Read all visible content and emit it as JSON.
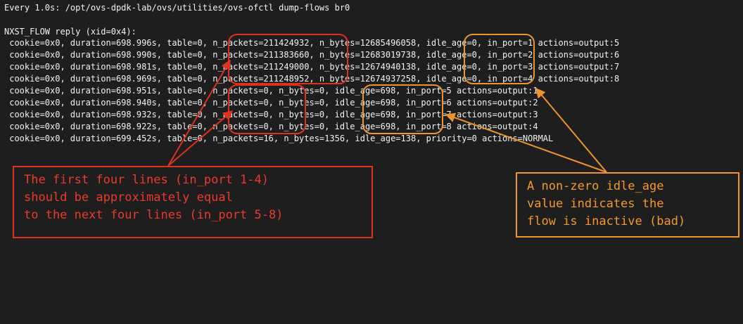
{
  "terminal": {
    "header": "Every 1.0s: /opt/ovs-dpdk-lab/ovs/utilities/ovs-ofctl dump-flows br0",
    "reply": "NXST_FLOW reply (xid=0x4):",
    "flows": [
      " cookie=0x0, duration=698.996s, table=0, n_packets=211424932, n_bytes=12685496058, idle_age=0, in_port=1 actions=output:5",
      " cookie=0x0, duration=698.990s, table=0, n_packets=211383660, n_bytes=12683019738, idle_age=0, in_port=2 actions=output:6",
      " cookie=0x0, duration=698.981s, table=0, n_packets=211249000, n_bytes=12674940138, idle_age=0, in_port=3 actions=output:7",
      " cookie=0x0, duration=698.969s, table=0, n_packets=211248952, n_bytes=12674937258, idle_age=0, in_port=4 actions=output:8",
      " cookie=0x0, duration=698.951s, table=0, n_packets=0, n_bytes=0, idle_age=698, in_port=5 actions=output:1",
      " cookie=0x0, duration=698.940s, table=0, n_packets=0, n_bytes=0, idle_age=698, in_port=6 actions=output:2",
      " cookie=0x0, duration=698.932s, table=0, n_packets=0, n_bytes=0, idle_age=698, in_port=7 actions=output:3",
      " cookie=0x0, duration=698.922s, table=0, n_packets=0, n_bytes=0, idle_age=698, in_port=8 actions=output:4",
      " cookie=0x0, duration=699.452s, table=0, n_packets=16, n_bytes=1356, idle_age=138, priority=0 actions=NORMAL"
    ]
  },
  "annotations": {
    "red_note": "The first four lines (in_port 1-4)\nshould be approximately equal\nto the next four lines (in_port 5-8)",
    "orange_note": "A non-zero idle_age\nvalue indicates the\nflow is inactive (bad)"
  },
  "colors": {
    "background": "#1e1e1e",
    "text": "#f2f2f2",
    "annotation_red": "#e0311f",
    "annotation_orange": "#f0922e"
  }
}
